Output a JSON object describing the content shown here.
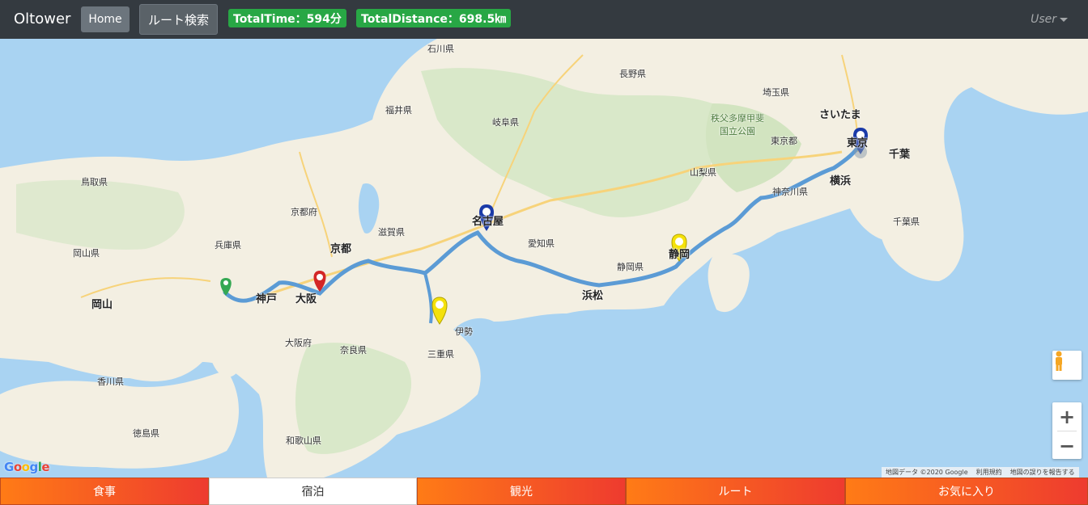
{
  "nav": {
    "brand": "Oltower",
    "home_label": "Home",
    "route_search_label": "ルート検索",
    "total_time": "TotalTime：594分",
    "total_distance": "TotalDistance：698.5㎞",
    "user_label": "User"
  },
  "map": {
    "labels": {
      "ishikawa": "石川県",
      "fukui": "福井県",
      "gifu": "岐阜県",
      "nagano": "長野県",
      "saitama_pref": "埼玉県",
      "saitama": "さいたま",
      "tokyo": "東京",
      "tokyo_pref": "東京都",
      "chiba": "千葉",
      "chiba_pref": "千葉県",
      "yokohama": "横浜",
      "kanagawa": "神奈川県",
      "yamanashi": "山梨県",
      "shizuoka_pref": "静岡県",
      "shizuoka": "静岡",
      "hamamatsu": "浜松",
      "aichi": "愛知県",
      "nagoya": "名古屋",
      "mie": "三重県",
      "shiga": "滋賀県",
      "kyoto": "京都",
      "kyoto_pref": "京都府",
      "osaka": "大阪",
      "osaka_pref": "大阪府",
      "kobe": "神戸",
      "hyogo": "兵庫県",
      "nara": "奈良県",
      "wakayama": "和歌山県",
      "tottori": "鳥取県",
      "okayama_pref": "岡山県",
      "okayama": "岡山",
      "kagawa": "香川県",
      "tokushima": "徳島県",
      "ise": "伊勢",
      "chichibu": "秩父多摩甲斐\n国立公園"
    },
    "google_text": "Google",
    "attribution": [
      "地図データ ©2020 Google",
      "利用規約",
      "地図の誤りを報告する"
    ],
    "zoom_in": "+",
    "zoom_out": "−"
  },
  "tabs": [
    "食事",
    "宿泊",
    "観光",
    "ルート",
    "お気に入り"
  ],
  "active_tab": "宿泊",
  "colors": {
    "navbar": "#343a40",
    "badge": "#28a745",
    "route": "#5b9bd5",
    "tab_gradient_start": "#ff7b16",
    "tab_gradient_end": "#ee3b2f"
  }
}
